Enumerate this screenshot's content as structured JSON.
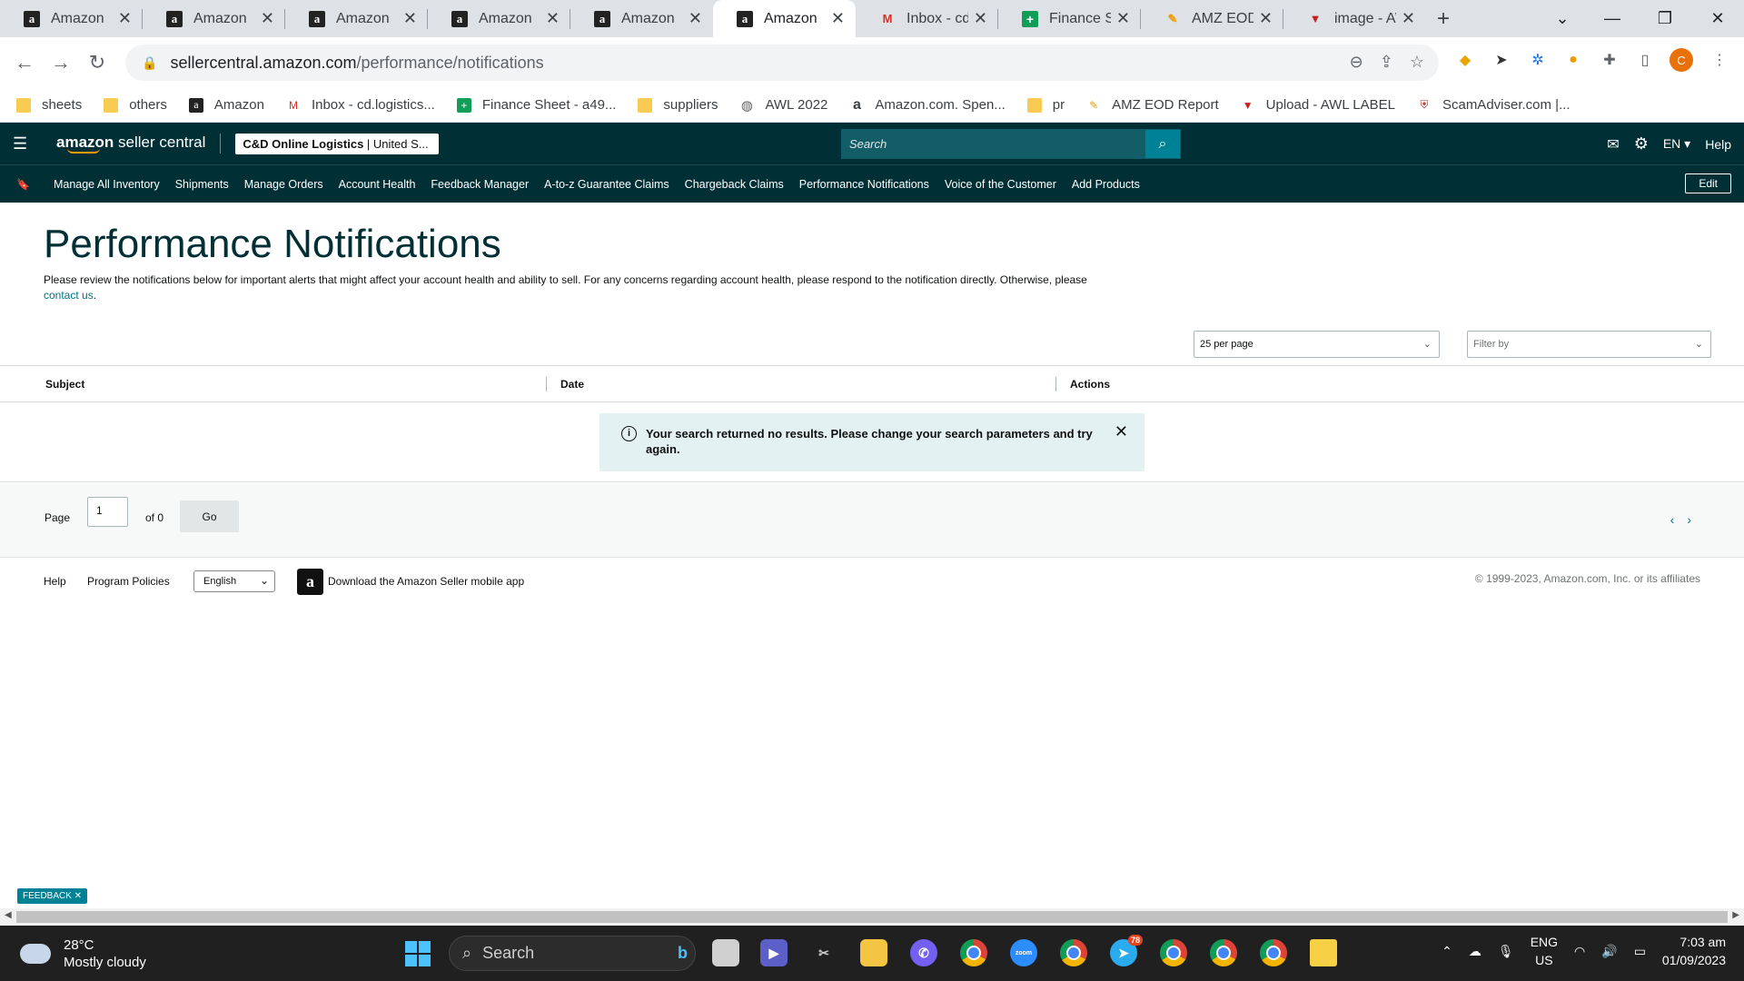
{
  "browser": {
    "tabs": [
      {
        "title": "Amazon",
        "icon": "amazon-icon",
        "active": false
      },
      {
        "title": "Amazon",
        "icon": "amazon-icon",
        "active": false
      },
      {
        "title": "Amazon",
        "icon": "amazon-icon",
        "active": false
      },
      {
        "title": "Amazon",
        "icon": "amazon-icon",
        "active": false
      },
      {
        "title": "Amazon",
        "icon": "amazon-icon",
        "active": false
      },
      {
        "title": "Amazon",
        "icon": "amazon-icon",
        "active": true
      },
      {
        "title": "Inbox - cd.lo",
        "icon": "gmail-icon",
        "active": false
      },
      {
        "title": "Finance She",
        "icon": "sheets-icon",
        "active": false
      },
      {
        "title": "AMZ EOD R",
        "icon": "eod-icon",
        "active": false
      },
      {
        "title": "image - AW",
        "icon": "awl-icon",
        "active": false
      }
    ],
    "url_host": "sellercentral.amazon.com",
    "url_path": "/performance/notifications",
    "profile_initial": "C",
    "bookmarks": [
      {
        "label": "sheets",
        "icon": "folder-icon"
      },
      {
        "label": "others",
        "icon": "folder-icon"
      },
      {
        "label": "Amazon",
        "icon": "amazon-icon"
      },
      {
        "label": "Inbox - cd.logistics...",
        "icon": "gmail-icon"
      },
      {
        "label": "Finance Sheet - a49...",
        "icon": "sheets-icon"
      },
      {
        "label": "suppliers",
        "icon": "folder-icon"
      },
      {
        "label": "AWL 2022",
        "icon": "globe-icon"
      },
      {
        "label": "Amazon.com. Spen...",
        "icon": "amazon-a-icon"
      },
      {
        "label": "pr",
        "icon": "folder-icon"
      },
      {
        "label": "AMZ EOD Report",
        "icon": "eod-icon"
      },
      {
        "label": "Upload - AWL LABEL",
        "icon": "awl-icon"
      },
      {
        "label": "ScamAdviser.com |...",
        "icon": "shield-icon"
      }
    ]
  },
  "header": {
    "logo_bold": "amazon",
    "logo_rest": " seller central",
    "account_bold": "C&D Online Logistics",
    "account_rest": " | United S...",
    "search_placeholder": "Search",
    "language": "EN",
    "help": "Help"
  },
  "nav": {
    "items": [
      "Manage All Inventory",
      "Shipments",
      "Manage Orders",
      "Account Health",
      "Feedback Manager",
      "A-to-z Guarantee Claims",
      "Chargeback Claims",
      "Performance Notifications",
      "Voice of the Customer",
      "Add Products"
    ],
    "edit": "Edit"
  },
  "page": {
    "title": "Performance Notifications",
    "intro": "Please review the notifications below for important alerts that might affect your account health and ability to sell. For any concerns regarding account health, please respond to the notification directly. Otherwise, please ",
    "contact_link": "contact us",
    "intro_end": ".",
    "per_page": "25 per page",
    "filter_placeholder": "Filter by",
    "columns": {
      "subject": "Subject",
      "date": "Date",
      "actions": "Actions"
    },
    "alert": "Your search returned no results. Please change your search parameters and try again.",
    "pager": {
      "label": "Page",
      "value": "1",
      "of": "of 0",
      "go": "Go"
    }
  },
  "footer": {
    "help": "Help",
    "policies": "Program Policies",
    "language": "English",
    "app": "Download the Amazon Seller mobile app",
    "copyright": "© 1999-2023, Amazon.com, Inc. or its affiliates",
    "feedback": "FEEDBACK ✕"
  },
  "taskbar": {
    "temp": "28°C",
    "weather": "Mostly cloudy",
    "search": "Search",
    "telegram_badge": "78",
    "lang1": "ENG",
    "lang2": "US",
    "time": "7:03 am",
    "date": "01/09/2023"
  },
  "colors": {
    "header_bg": "#002f36",
    "accent": "#008296",
    "link": "#007185",
    "alert_bg": "#e4f1f2"
  }
}
